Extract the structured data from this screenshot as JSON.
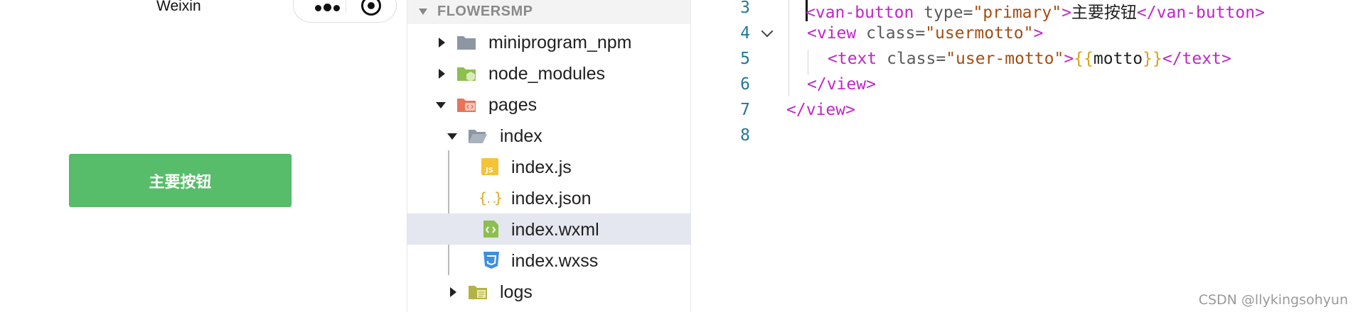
{
  "simulator": {
    "nav_title": "Weixin",
    "primary_button_label": "主要按钮"
  },
  "explorer": {
    "project_title": "FLOWERSMP",
    "items": [
      {
        "label": "miniprogram_npm",
        "icon": "folder-icon",
        "expanded": false
      },
      {
        "label": "node_modules",
        "icon": "node-folder-icon",
        "expanded": false
      },
      {
        "label": "pages",
        "icon": "pages-folder-icon",
        "expanded": true
      },
      {
        "label": "index",
        "icon": "folder-open-icon",
        "expanded": true
      },
      {
        "label": "index.js",
        "icon": "js-file-icon"
      },
      {
        "label": "index.json",
        "icon": "json-file-icon"
      },
      {
        "label": "index.wxml",
        "icon": "wxml-file-icon",
        "selected": true
      },
      {
        "label": "index.wxss",
        "icon": "css-file-icon"
      },
      {
        "label": "logs",
        "icon": "logs-folder-icon",
        "expanded": false
      }
    ]
  },
  "editor": {
    "lines": [
      {
        "num": "3",
        "tokens": [
          "<",
          "van-button",
          " type=",
          "\"primary\"",
          ">",
          "主要按钮",
          "</",
          "van-button",
          ">"
        ]
      },
      {
        "num": "4",
        "tokens": [
          "<",
          "view",
          " class=",
          "\"usermotto\"",
          ">"
        ]
      },
      {
        "num": "5",
        "tokens": [
          "<",
          "text",
          " class=",
          "\"user-motto\"",
          ">",
          "{{",
          "motto",
          "}}",
          "</",
          "text",
          ">"
        ]
      },
      {
        "num": "6",
        "tokens": [
          "</",
          "view",
          ">"
        ]
      },
      {
        "num": "7",
        "tokens": [
          "</",
          "view",
          ">"
        ]
      },
      {
        "num": "8",
        "tokens": []
      }
    ]
  },
  "watermark": "CSDN @llykingsohyun",
  "colors": {
    "primary_button": "#57bd6a",
    "tag": "#c026c8",
    "string": "#a34e14",
    "line_number": "#237893",
    "selection": "#e4e6f0"
  }
}
